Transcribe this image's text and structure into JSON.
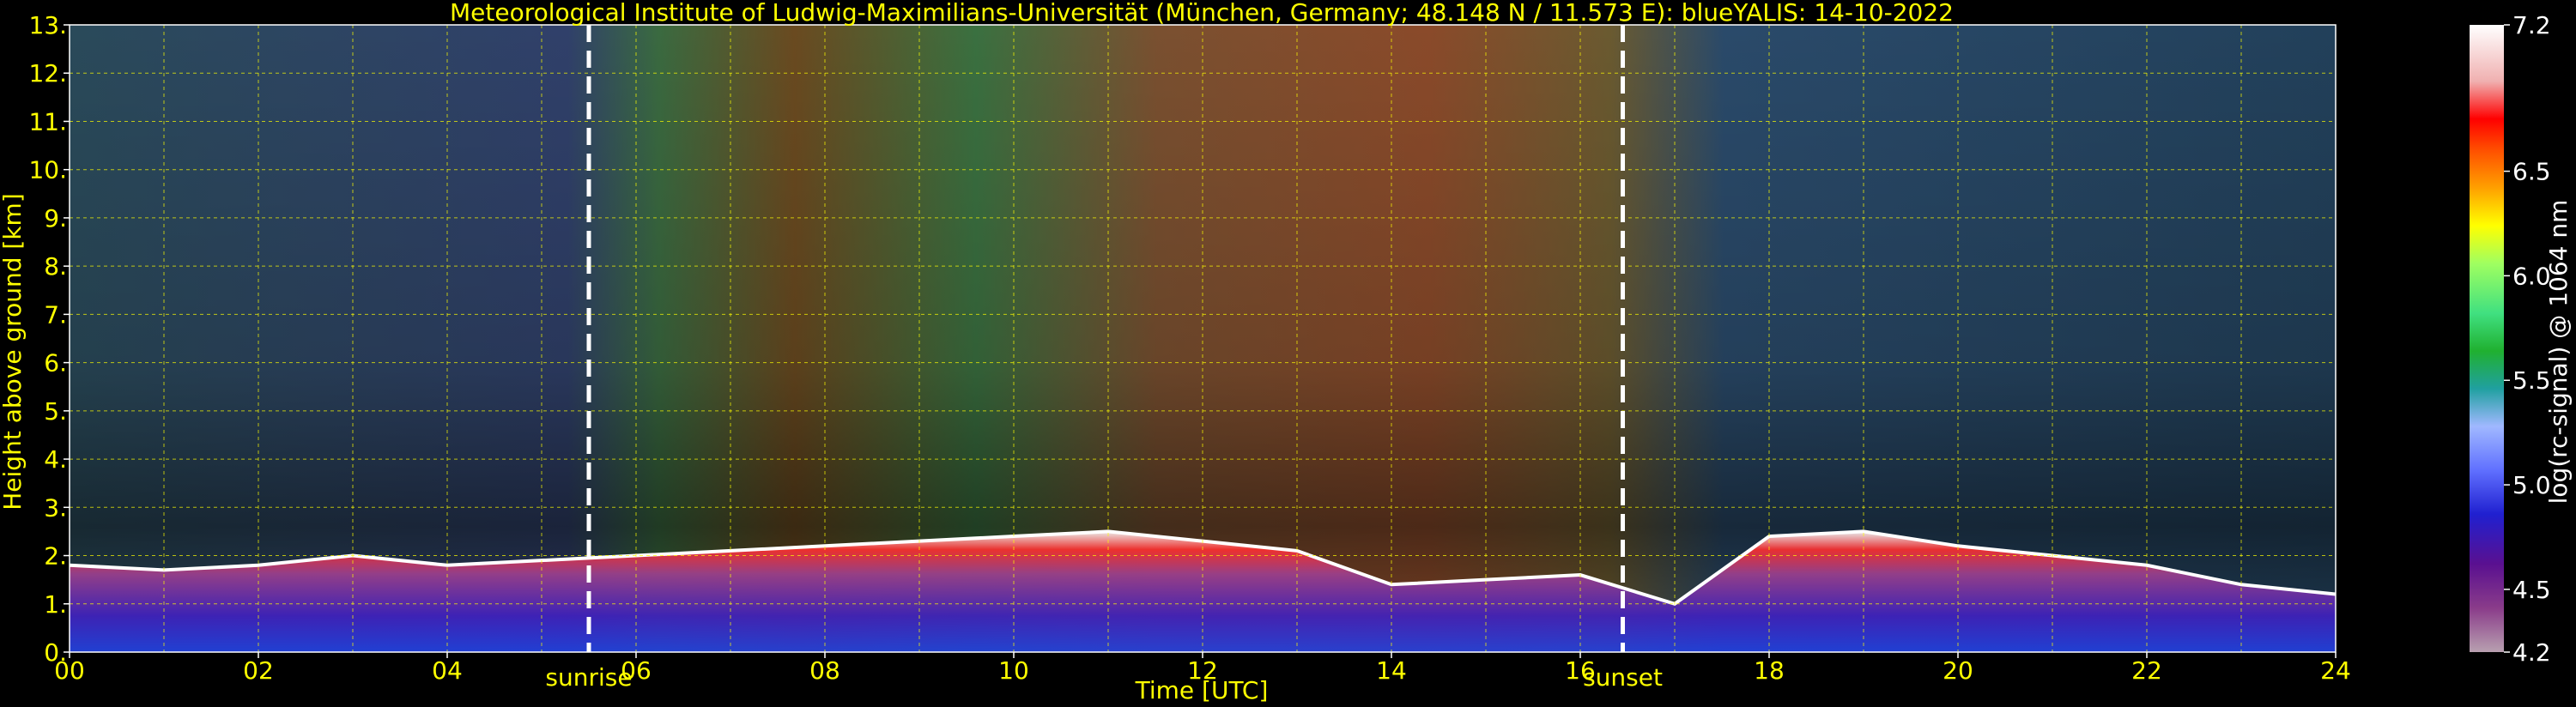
{
  "chart_data": {
    "type": "heatmap",
    "title": "Meteorological Institute of Ludwig-Maximilians-Universität (München, Germany; 48.148 N / 11.573 E):    blueYALIS: 14-10-2022",
    "xlabel": "Time [UTC]",
    "ylabel": "Height above ground [km]",
    "colorbar_label": "log(rc-signal) @ 1064 nm",
    "xlim": [
      0,
      24
    ],
    "ylim": [
      0,
      13
    ],
    "clim": [
      4.2,
      7.2
    ],
    "grid": true,
    "x_ticks": [
      0,
      2,
      4,
      6,
      8,
      10,
      12,
      14,
      16,
      18,
      20,
      22,
      24
    ],
    "x_tick_labels": [
      "00",
      "02",
      "04",
      "06",
      "08",
      "10",
      "12",
      "14",
      "16",
      "18",
      "20",
      "22",
      "24"
    ],
    "y_ticks": [
      0,
      1,
      2,
      3,
      4,
      5,
      6,
      7,
      8,
      9,
      10,
      11,
      12,
      13
    ],
    "y_tick_labels": [
      "0.",
      "1.",
      "2.",
      "3.",
      "4.",
      "5.",
      "6.",
      "7.",
      "8.",
      "9.",
      "10.",
      "11.",
      "12.",
      "13."
    ],
    "colorbar_ticks": [
      4.2,
      4.5,
      5.0,
      5.5,
      6.0,
      6.5,
      7.2
    ],
    "colorbar_tick_labels": [
      "4.2",
      "4.5",
      "5.0",
      "5.5",
      "6.0",
      "6.5",
      "7.2"
    ],
    "markers": [
      {
        "label": "sunrise",
        "x": 5.5
      },
      {
        "label": "sunset",
        "x": 16.45
      }
    ],
    "boundary_layer_top_km": [
      [
        0,
        1.8
      ],
      [
        1,
        1.7
      ],
      [
        2,
        1.8
      ],
      [
        3,
        2.0
      ],
      [
        4,
        1.8
      ],
      [
        5,
        1.9
      ],
      [
        6,
        2.0
      ],
      [
        7,
        2.1
      ],
      [
        8,
        2.2
      ],
      [
        9,
        2.3
      ],
      [
        10,
        2.4
      ],
      [
        11,
        2.5
      ],
      [
        12,
        2.3
      ],
      [
        13,
        2.1
      ],
      [
        14,
        1.4
      ],
      [
        15,
        1.5
      ],
      [
        16,
        1.6
      ],
      [
        17,
        1.0
      ],
      [
        18,
        2.4
      ],
      [
        19,
        2.5
      ],
      [
        20,
        2.2
      ],
      [
        21,
        2.0
      ],
      [
        22,
        1.8
      ],
      [
        23,
        1.4
      ],
      [
        24,
        1.2
      ]
    ],
    "colors": {
      "text": "#ffff00",
      "grid": "#ffff00",
      "background": "#000000",
      "colormap": [
        "#b8a0b0",
        "#8a3c8a",
        "#5a1090",
        "#2020d0",
        "#6070ff",
        "#a0b8ff",
        "#20a0a0",
        "#20b030",
        "#40e080",
        "#a0ff60",
        "#ffff00",
        "#ffa000",
        "#ff5000",
        "#ff0000",
        "#f0b0b0",
        "#ffffff"
      ]
    }
  }
}
